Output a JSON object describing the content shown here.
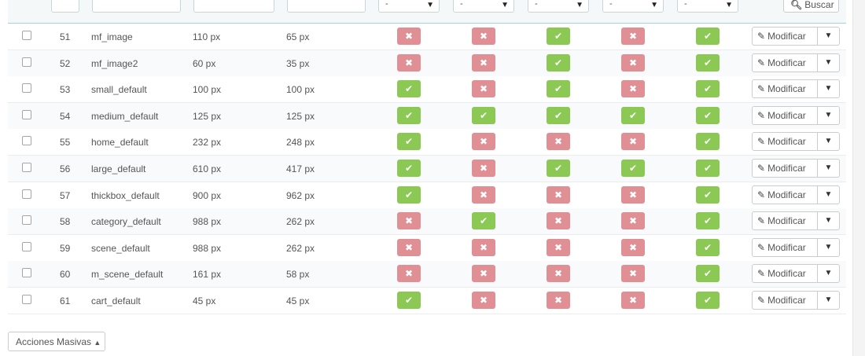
{
  "filters": {
    "select_default": "-",
    "search_label": "Buscar"
  },
  "row_action": {
    "edit_label": "Modificar"
  },
  "bulk_actions_label": "Acciones Masivas",
  "colors": {
    "ok": "#8bc954",
    "no": "#e08f95"
  },
  "rows": [
    {
      "id": "51",
      "name": "mf_image",
      "width": "110 px",
      "height": "65 px",
      "flags": [
        false,
        false,
        true,
        false,
        true
      ]
    },
    {
      "id": "52",
      "name": "mf_image2",
      "width": "60 px",
      "height": "35 px",
      "flags": [
        false,
        false,
        true,
        false,
        true
      ]
    },
    {
      "id": "53",
      "name": "small_default",
      "width": "100 px",
      "height": "100 px",
      "flags": [
        true,
        false,
        true,
        false,
        true
      ]
    },
    {
      "id": "54",
      "name": "medium_default",
      "width": "125 px",
      "height": "125 px",
      "flags": [
        true,
        true,
        true,
        true,
        true
      ]
    },
    {
      "id": "55",
      "name": "home_default",
      "width": "232 px",
      "height": "248 px",
      "flags": [
        true,
        false,
        false,
        false,
        true
      ]
    },
    {
      "id": "56",
      "name": "large_default",
      "width": "610 px",
      "height": "417 px",
      "flags": [
        true,
        false,
        true,
        true,
        true
      ]
    },
    {
      "id": "57",
      "name": "thickbox_default",
      "width": "900 px",
      "height": "962 px",
      "flags": [
        true,
        false,
        false,
        false,
        true
      ]
    },
    {
      "id": "58",
      "name": "category_default",
      "width": "988 px",
      "height": "262 px",
      "flags": [
        false,
        true,
        false,
        false,
        true
      ]
    },
    {
      "id": "59",
      "name": "scene_default",
      "width": "988 px",
      "height": "262 px",
      "flags": [
        false,
        false,
        false,
        false,
        true
      ]
    },
    {
      "id": "60",
      "name": "m_scene_default",
      "width": "161 px",
      "height": "58 px",
      "flags": [
        false,
        false,
        false,
        false,
        true
      ]
    },
    {
      "id": "61",
      "name": "cart_default",
      "width": "45 px",
      "height": "45 px",
      "flags": [
        true,
        false,
        false,
        false,
        true
      ]
    }
  ]
}
